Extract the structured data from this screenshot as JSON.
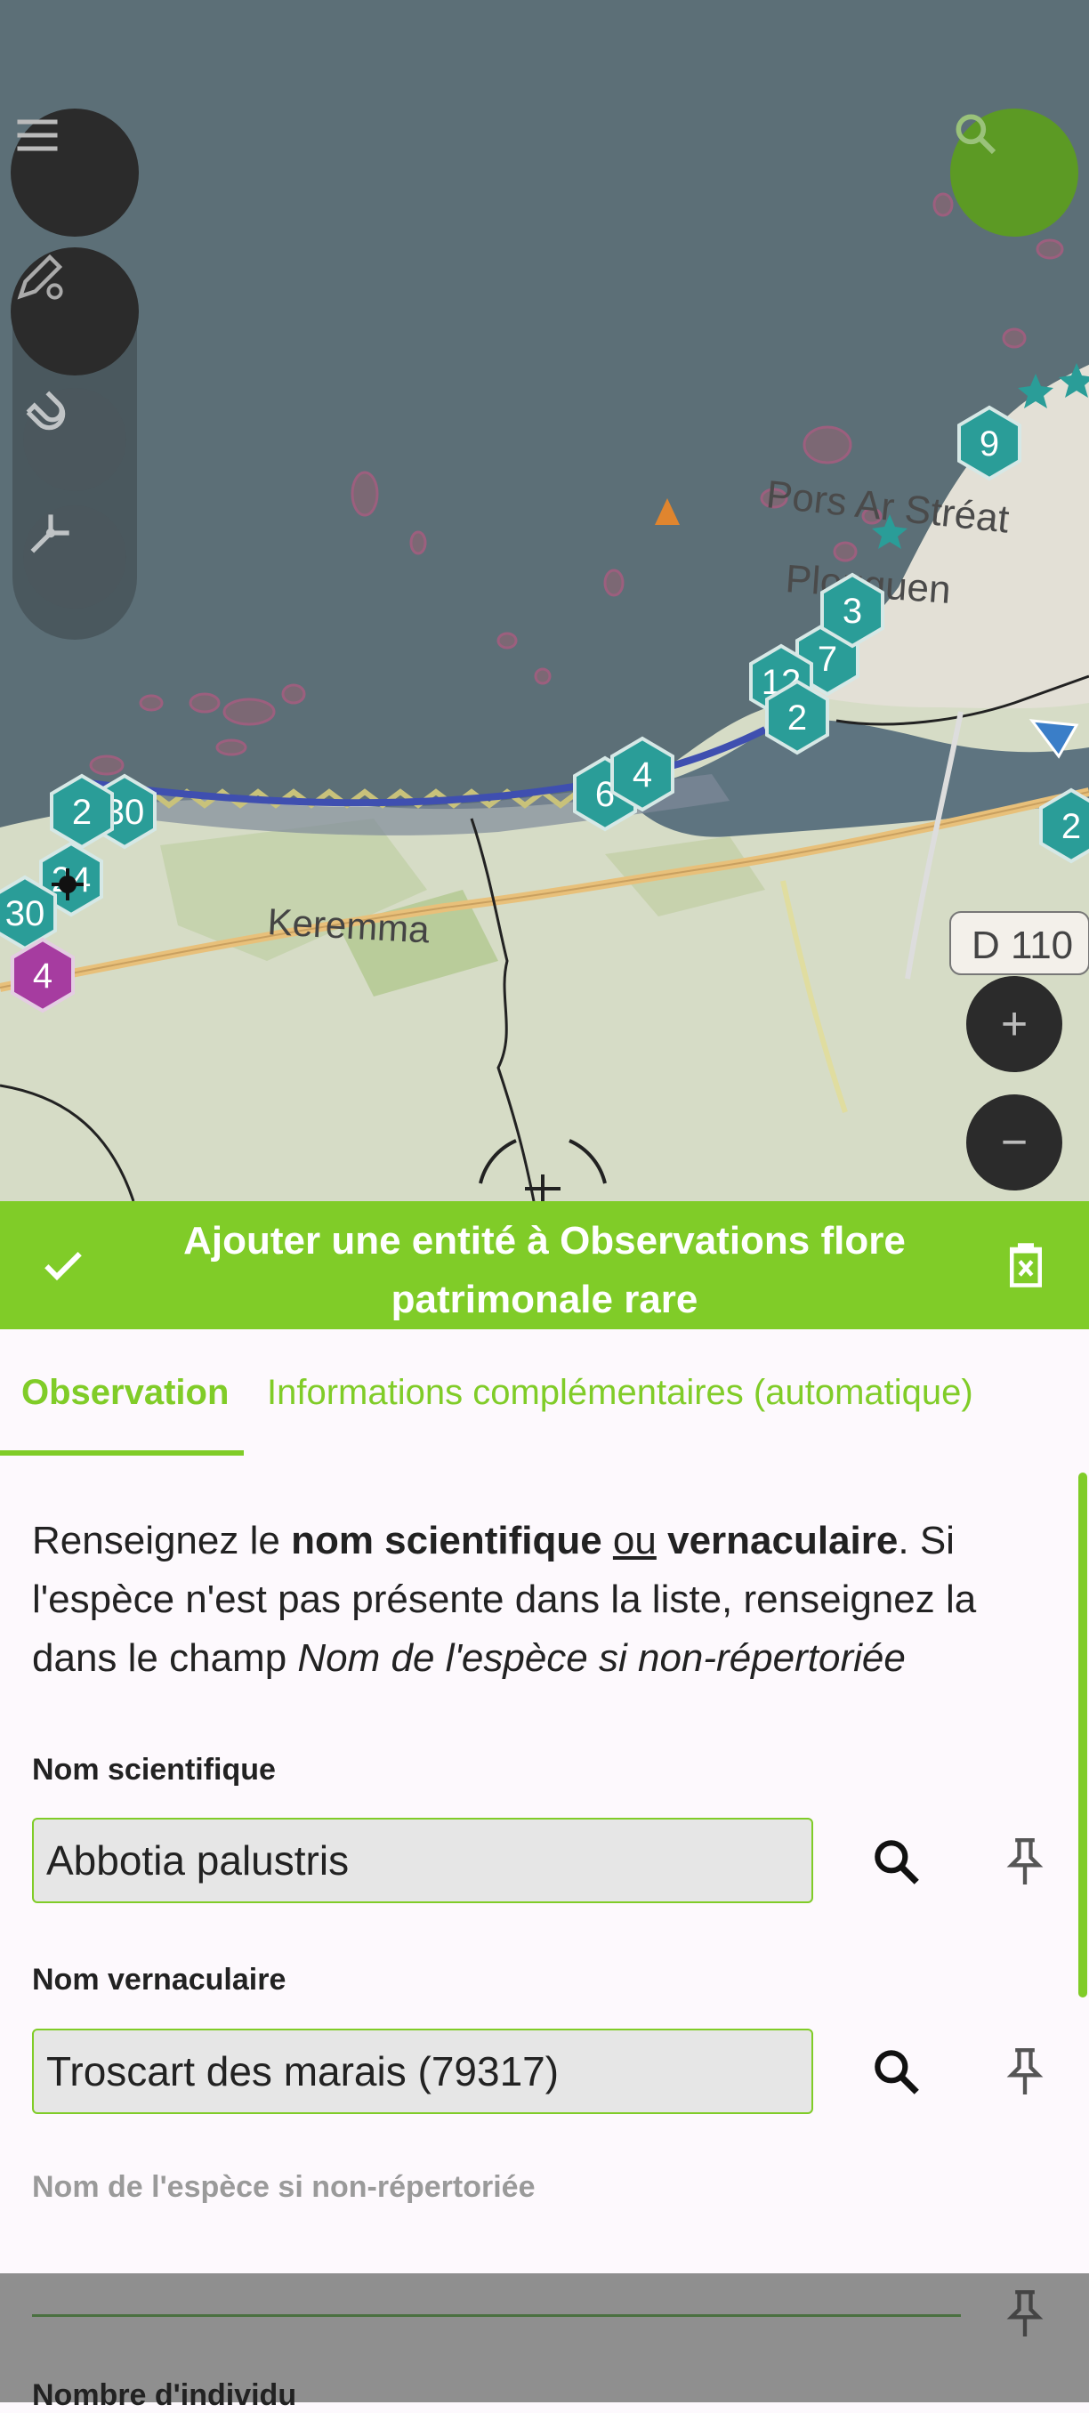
{
  "map": {
    "place_labels": {
      "keremma": "Keremma",
      "pors_ar_streat": "Pors Ar Stréat",
      "plouguen": "Plouguen",
      "road_d110": "D 110"
    },
    "clusters": [
      "9",
      "3",
      "7",
      "12",
      "2",
      "4",
      "6",
      "2",
      "30",
      "24",
      "30",
      "4",
      "2"
    ]
  },
  "controls": {
    "zoom_in": "+",
    "zoom_out": "−"
  },
  "form": {
    "title_line1": "Ajouter une entité à Observations flore",
    "title_line2": "patrimonale rare",
    "tabs": {
      "observation": "Observation",
      "info": "Informations complémentaires (automatique)"
    },
    "intro": {
      "p1": "Renseignez le ",
      "b1": "nom scientifique",
      "p2": " ",
      "u1": "ou",
      "p3": " ",
      "b2": "vernaculaire",
      "p4": ". Si l'espèce n'est pas présente dans la liste, renseignez la dans le champ ",
      "i1": "Nom de l'espèce si non-répertoriée"
    },
    "fields": {
      "scientific_label": "Nom scientifique",
      "scientific_value": "Abbotia palustris",
      "vernacular_label": "Nom vernaculaire",
      "vernacular_value": "Troscart des marais (79317)",
      "unlisted_label": "Nom de l'espèce si non-répertoriée",
      "count_label": "Nombre d'individu"
    }
  },
  "colors": {
    "accent": "#80cc28",
    "sea": "#5c6f77",
    "cluster_teal": "#2a9d98",
    "cluster_magenta": "#a63ca0"
  }
}
